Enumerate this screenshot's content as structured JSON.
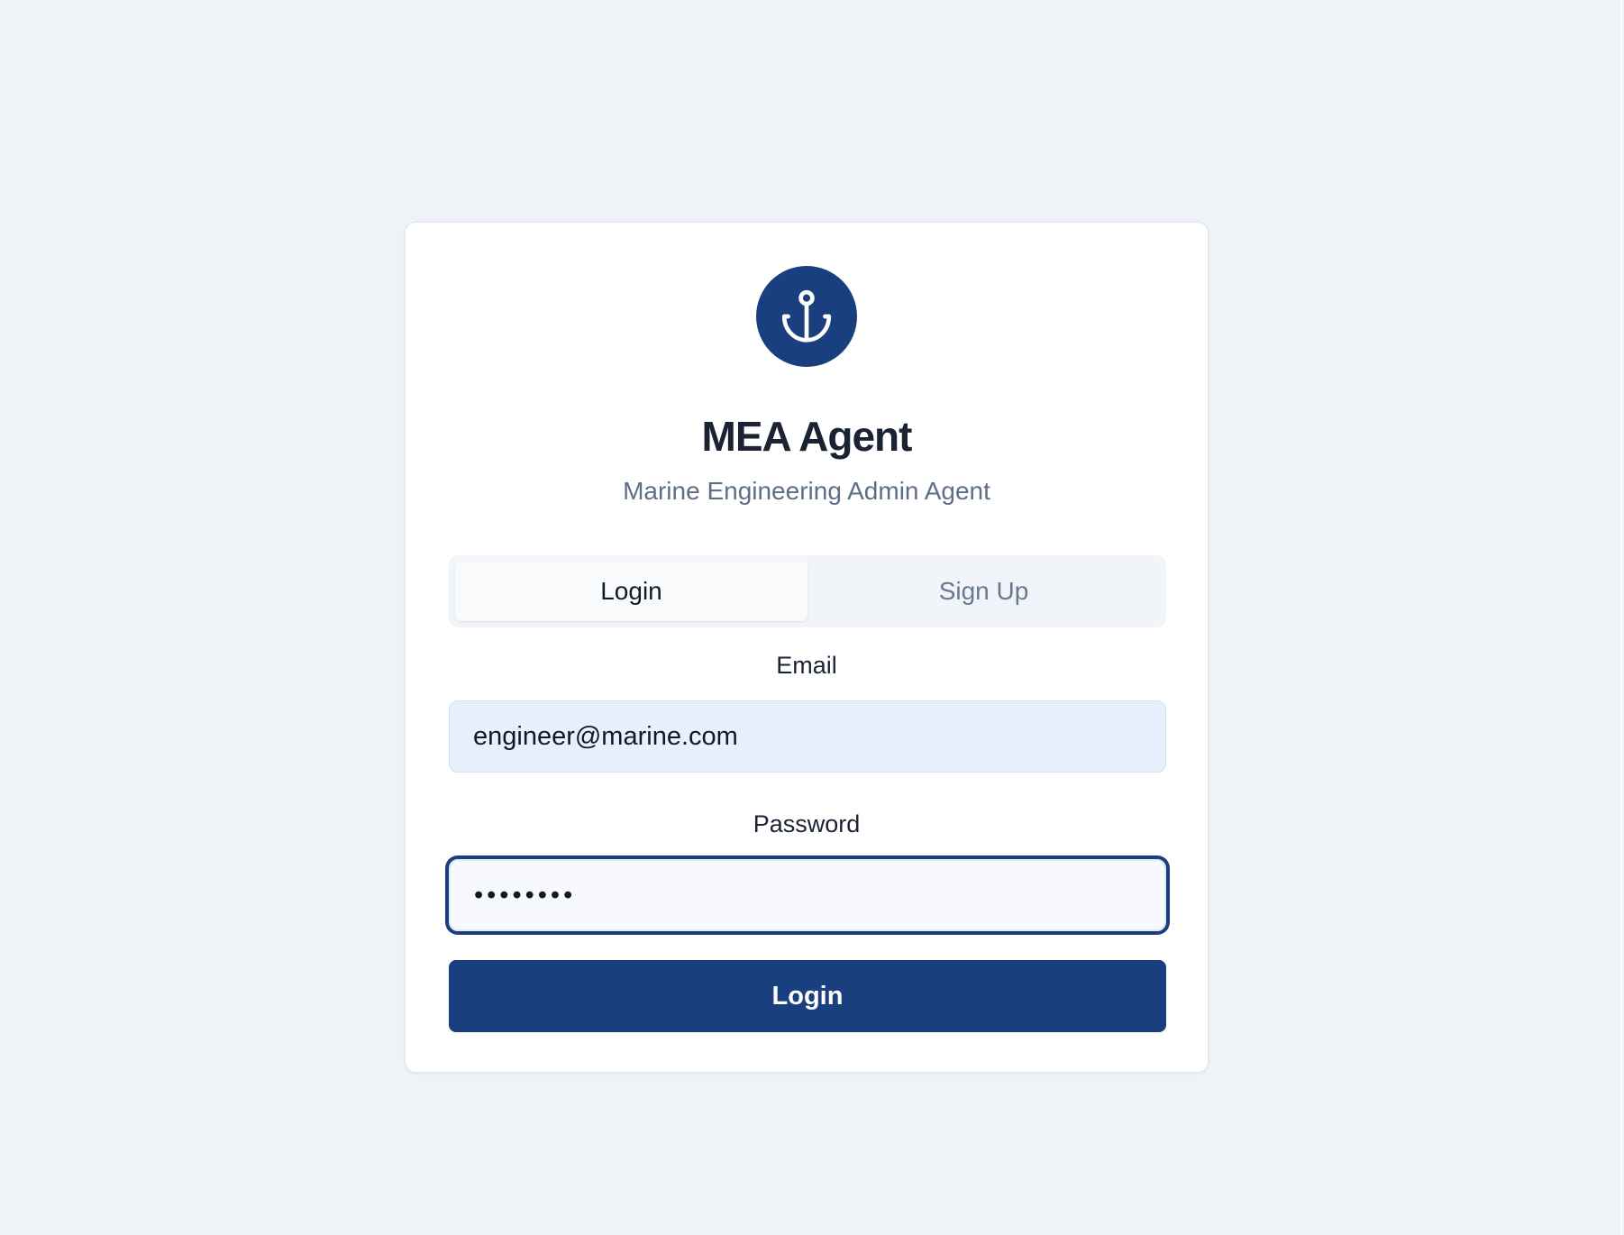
{
  "app": {
    "logo_icon": "anchor-icon",
    "title": "MEA Agent",
    "subtitle": "Marine Engineering Admin Agent"
  },
  "tabs": [
    {
      "label": "Login",
      "active": true
    },
    {
      "label": "Sign Up",
      "active": false
    }
  ],
  "form": {
    "email_label": "Email",
    "email_value": "engineer@marine.com",
    "password_label": "Password",
    "password_value": "••••••••",
    "password_focused": true,
    "submit_label": "Login"
  },
  "colors": {
    "brand": "#1a3f7e",
    "page_background": "#eff3f8",
    "email_autofill_background": "#e9f0fd",
    "muted_text": "#5e6e87"
  }
}
